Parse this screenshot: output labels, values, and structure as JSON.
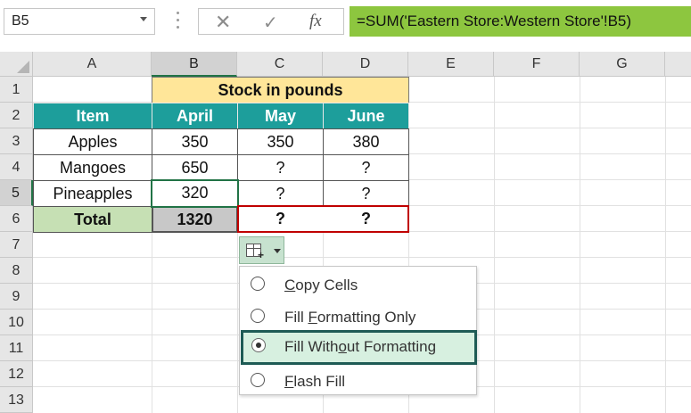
{
  "formula_bar": {
    "name_box": "B5",
    "cancel_glyph": "✕",
    "enter_glyph": "✓",
    "fx_label": "fx",
    "formula": "=SUM('Eastern Store:Western Store'!B5)"
  },
  "columns": [
    "A",
    "B",
    "C",
    "D",
    "E",
    "F",
    "G"
  ],
  "rows": [
    "1",
    "2",
    "3",
    "4",
    "5",
    "6",
    "7",
    "8",
    "9",
    "10",
    "11",
    "12",
    "13"
  ],
  "table": {
    "title": "Stock in pounds",
    "headers": [
      "Item",
      "April",
      "May",
      "June"
    ],
    "data": [
      [
        "Apples",
        "350",
        "350",
        "380"
      ],
      [
        "Mangoes",
        "650",
        "?",
        "?"
      ],
      [
        "Pineapples",
        "320",
        "?",
        "?"
      ]
    ],
    "total": [
      "Total",
      "1320",
      "?",
      "?"
    ]
  },
  "autofill_menu": {
    "items": [
      {
        "pre": "",
        "ul": "C",
        "post": "opy Cells",
        "selected": false
      },
      {
        "pre": "Fill ",
        "ul": "F",
        "post": "ormatting Only",
        "selected": false
      },
      {
        "pre": "Fill With",
        "ul": "o",
        "post": "ut Formatting",
        "selected": true
      },
      {
        "pre": "",
        "ul": "F",
        "post": "lash Fill",
        "selected": false
      }
    ]
  },
  "colors": {
    "header_teal": "#1d9e9b",
    "title_yellow": "#ffe699",
    "total_green": "#c6e0b4",
    "formula_green": "#8dc63f",
    "selection_green": "#217346",
    "red_border": "#c00000"
  }
}
